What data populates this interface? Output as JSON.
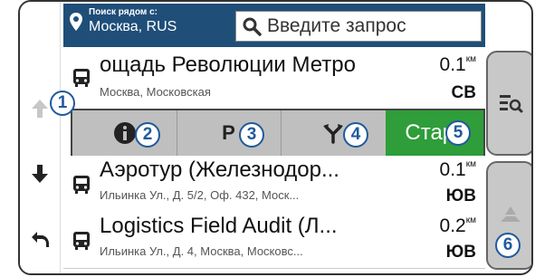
{
  "header": {
    "location_label": "Поиск рядом с:",
    "location_value": "Москва, RUS",
    "search_placeholder": "Введите запрос"
  },
  "results": [
    {
      "title": "ощадь Революции Метро",
      "subtitle": "Москва, Московская",
      "distance": "0.1",
      "distance_unit": "км",
      "direction": "СВ"
    },
    {
      "title": "Аэротур (Железнодор...",
      "subtitle": "Ильинка Ул., Д. 5/2, Оф. 432, Моск...",
      "distance": "0.1",
      "distance_unit": "км",
      "direction": "ЮВ"
    },
    {
      "title": "Logistics Field Audit (Л...",
      "subtitle": "Ильинка Ул., Д. 4, Москва, Московс...",
      "distance": "0.2",
      "distance_unit": "км",
      "direction": "ЮВ"
    }
  ],
  "actions": {
    "info_label": "i",
    "parking_label": "P",
    "start_label": "Старт"
  },
  "callouts": [
    "1",
    "2",
    "3",
    "4",
    "5",
    "6"
  ],
  "colors": {
    "header": "#1f4e79",
    "start": "#2e9d3a",
    "callout": "#1f5a9c"
  },
  "icons": [
    "location-pin-icon",
    "search-icon",
    "bus-icon",
    "info-icon",
    "parking-icon",
    "route-fork-icon",
    "arrow-up-icon",
    "arrow-down-icon",
    "back-icon",
    "filter-list-icon",
    "map-pin-icon"
  ]
}
